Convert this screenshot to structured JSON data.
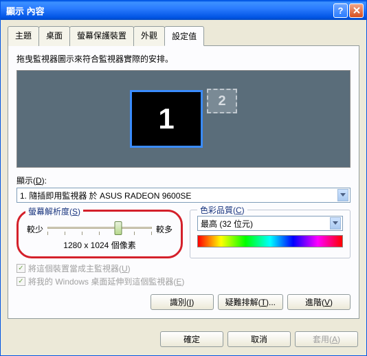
{
  "window": {
    "title": "顯示 內容"
  },
  "tabs": {
    "items": [
      {
        "label": "主題"
      },
      {
        "label": "桌面"
      },
      {
        "label": "螢幕保護裝置"
      },
      {
        "label": "外觀"
      },
      {
        "label": "設定值"
      }
    ],
    "active": 4
  },
  "instruction": "拖曳監視器圖示來符合監視器實際的安排。",
  "monitors": {
    "primary": "1",
    "secondary": "2"
  },
  "display_label_pre": "顯示(",
  "display_label_u": "D",
  "display_label_post": "):",
  "display_value": "1. 隨插即用監視器 於 ASUS RADEON 9600SE",
  "resolution": {
    "legend_pre": "螢幕解析度(",
    "legend_u": "S",
    "legend_post": ")",
    "less": "較少",
    "more": "較多",
    "value": "1280 x 1024 個像素"
  },
  "colorquality": {
    "legend_pre": "色彩品質(",
    "legend_u": "C",
    "legend_post": ")",
    "value": "最高 (32 位元)"
  },
  "checkbox1_pre": "將這個裝置當成主監視器(",
  "checkbox1_u": "U",
  "checkbox1_post": ")",
  "checkbox2_pre": "將我的 Windows 桌面延伸到這個監視器(",
  "checkbox2_u": "E",
  "checkbox2_post": ")",
  "buttons": {
    "identify_pre": "識別(",
    "identify_u": "I",
    "identify_post": ")",
    "troubleshoot_pre": "疑難排解(",
    "troubleshoot_u": "T",
    "troubleshoot_post": ")...",
    "advanced_pre": "進階(",
    "advanced_u": "V",
    "advanced_post": ")"
  },
  "footer": {
    "ok": "確定",
    "cancel": "取消",
    "apply_pre": "套用(",
    "apply_u": "A",
    "apply_post": ")"
  }
}
